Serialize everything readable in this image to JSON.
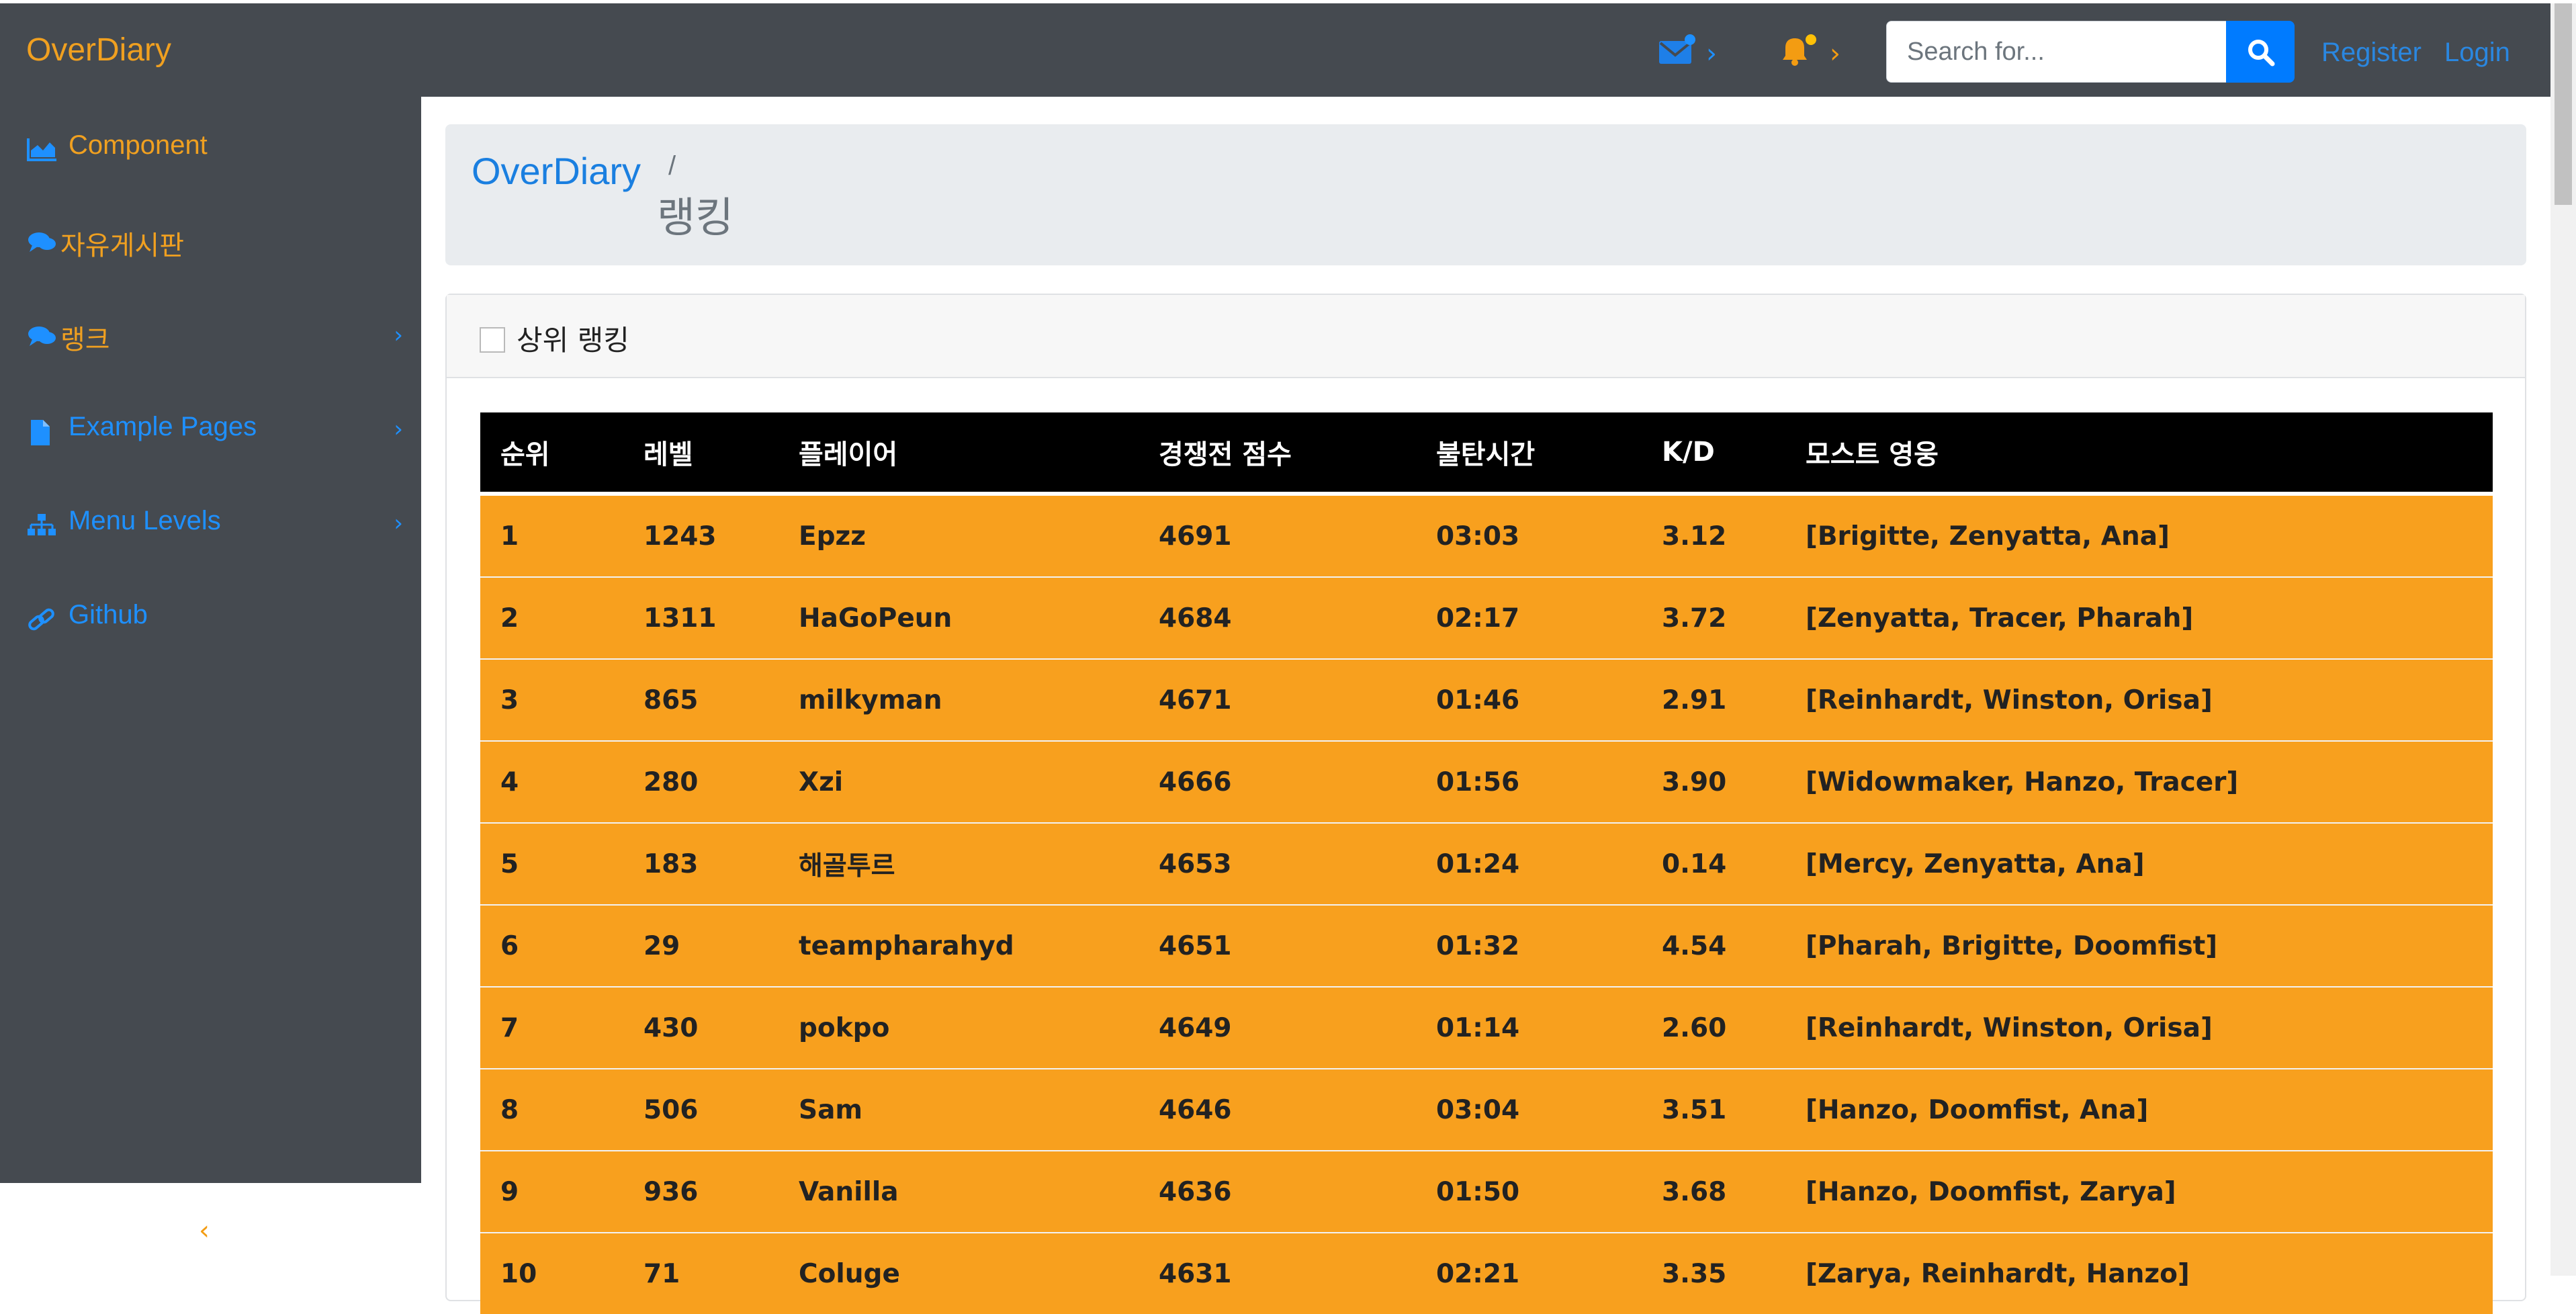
{
  "navbar": {
    "brand": "OverDiary",
    "search_placeholder": "Search for...",
    "register_label": "Register",
    "login_label": "Login",
    "colors": {
      "bar": "#454a50",
      "brand": "#f0a020",
      "link": "#2a87e0",
      "search_button": "#007bff"
    },
    "icons": [
      "envelope-icon",
      "bell-icon",
      "search-icon"
    ]
  },
  "sidebar": {
    "items": [
      {
        "label": "Component",
        "icon": "area-chart-icon",
        "color": "#f0a020",
        "has_submenu": false
      },
      {
        "label": "자유게시판",
        "icon": "comments-icon",
        "color": "#f0a020",
        "has_submenu": false
      },
      {
        "label": "랭크",
        "icon": "comments-icon",
        "color": "#f0a020",
        "has_submenu": true
      },
      {
        "label": "Example Pages",
        "icon": "file-icon",
        "color": "#1e90ff",
        "has_submenu": true
      },
      {
        "label": "Menu Levels",
        "icon": "sitemap-icon",
        "color": "#1e90ff",
        "has_submenu": true
      },
      {
        "label": "Github",
        "icon": "link-icon",
        "color": "#1e90ff",
        "has_submenu": false
      }
    ]
  },
  "breadcrumb": {
    "home": "OverDiary",
    "separator": "/",
    "current": "랭킹"
  },
  "card": {
    "title": "상위 랭킹",
    "table": {
      "headers": [
        "순위",
        "레벨",
        "플레이어",
        "경쟁전 점수",
        "불탄시간",
        "K/D",
        "모스트 영웅"
      ],
      "rows": [
        [
          "1",
          "1243",
          "Epzz",
          "4691",
          "03:03",
          "3.12",
          "[Brigitte, Zenyatta, Ana]"
        ],
        [
          "2",
          "1311",
          "HaGoPeun",
          "4684",
          "02:17",
          "3.72",
          "[Zenyatta, Tracer, Pharah]"
        ],
        [
          "3",
          "865",
          "milkyman",
          "4671",
          "01:46",
          "2.91",
          "[Reinhardt, Winston, Orisa]"
        ],
        [
          "4",
          "280",
          "Xzi",
          "4666",
          "01:56",
          "3.90",
          "[Widowmaker, Hanzo, Tracer]"
        ],
        [
          "5",
          "183",
          "해골투르",
          "4653",
          "01:24",
          "0.14",
          "[Mercy, Zenyatta, Ana]"
        ],
        [
          "6",
          "29",
          "teampharahyd",
          "4651",
          "01:32",
          "4.54",
          "[Pharah, Brigitte, Doomfist]"
        ],
        [
          "7",
          "430",
          "pokpo",
          "4649",
          "01:14",
          "2.60",
          "[Reinhardt, Winston, Orisa]"
        ],
        [
          "8",
          "506",
          "Sam",
          "4646",
          "03:04",
          "3.51",
          "[Hanzo, Doomfist, Ana]"
        ],
        [
          "9",
          "936",
          "Vanilla",
          "4636",
          "01:50",
          "3.68",
          "[Hanzo, Doomfist, Zarya]"
        ],
        [
          "10",
          "71",
          "Coluge",
          "4631",
          "02:21",
          "3.35",
          "[Zarya, Reinhardt, Hanzo]"
        ]
      ],
      "colors": {
        "header_bg": "#000000",
        "row_bg": "#f8a01e"
      }
    }
  }
}
